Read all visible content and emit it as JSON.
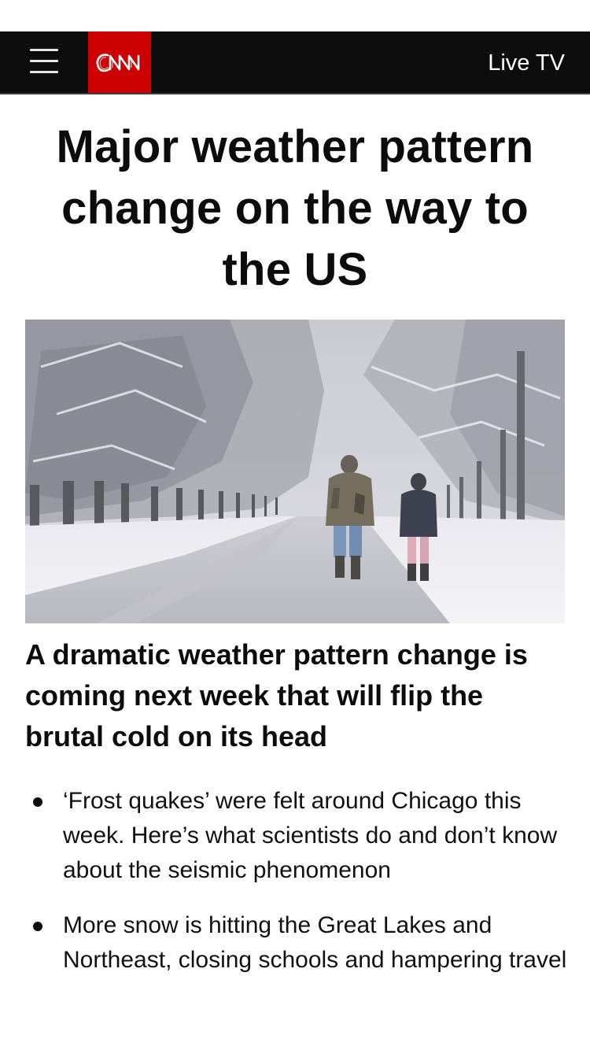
{
  "header": {
    "logo_text": "CNN",
    "live_tv_label": "Live TV",
    "brand_color": "#cc0000",
    "bar_color": "#0c0c0c"
  },
  "article": {
    "headline": "Major weather pattern change on the way to the US",
    "subheadline": "A dramatic weather pattern change is coming next week that will flip the brutal cold on its head",
    "related": [
      {
        "text": "‘Frost quakes’ were felt around Chicago this week. Here’s what scientists do and don’t know about the seismic phenomenon"
      },
      {
        "text": "More snow is hitting the Great Lakes and Northeast, closing schools and hampering travel"
      }
    ]
  }
}
